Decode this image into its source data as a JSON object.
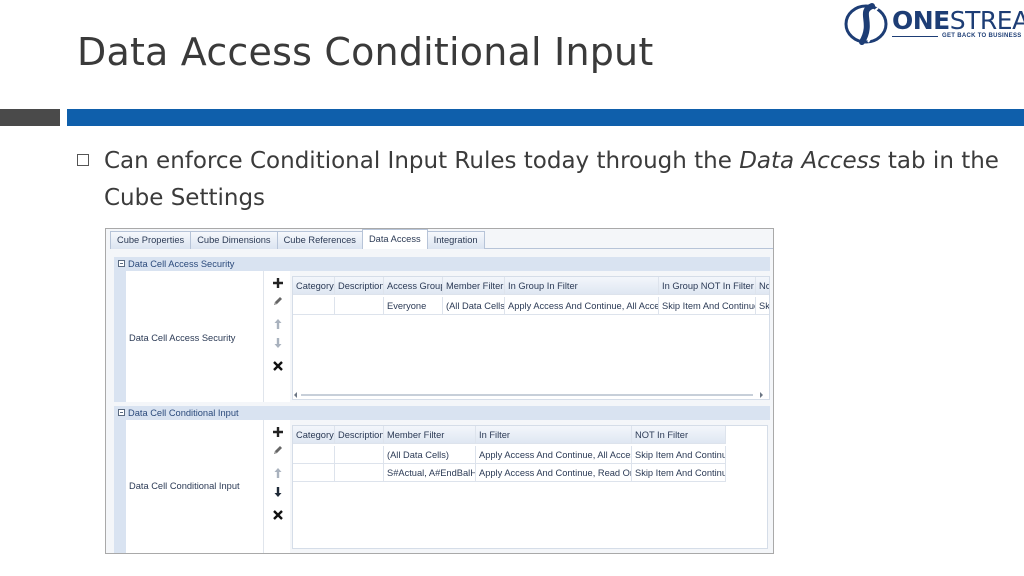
{
  "slide": {
    "title": "Data Access Conditional Input",
    "bullet_pre": "Can enforce Conditional Input Rules today through the ",
    "bullet_em": "Data Access",
    "bullet_post": " tab in the Cube Settings"
  },
  "logo": {
    "word_bold": "ONE",
    "word_light": "STREAM",
    "tagline": "GET BACK TO BUSINESS",
    "brand_color": "#1d3d75"
  },
  "colors": {
    "accent_band": "#0f5fab",
    "dark_band": "#4a4a4a",
    "section_header_bg": "#d9e3f1"
  },
  "tabs": [
    {
      "label": "Cube Properties",
      "active": false
    },
    {
      "label": "Cube Dimensions",
      "active": false
    },
    {
      "label": "Cube References",
      "active": false
    },
    {
      "label": "Data Access",
      "active": true
    },
    {
      "label": "Integration",
      "active": false
    }
  ],
  "security": {
    "header": "Data Cell Access Security",
    "label": "Data Cell Access Security",
    "tools": [
      "add-icon",
      "edit-icon",
      "move-up-icon",
      "move-down-icon",
      "delete-icon"
    ],
    "columns": [
      "Category",
      "Description",
      "Access Group",
      "Member Filter",
      "In Group In Filter",
      "In Group NOT In Filter",
      "No"
    ],
    "rows": [
      [
        "",
        "",
        "Everyone",
        "(All Data Cells)",
        "Apply Access And Continue, All Access",
        "Skip Item And Continue",
        "Sk"
      ]
    ]
  },
  "conditional": {
    "header": "Data Cell Conditional Input",
    "label": "Data Cell Conditional Input",
    "tools": [
      "add-icon",
      "edit-icon",
      "move-up-icon",
      "move-down-icon",
      "delete-icon"
    ],
    "columns": [
      "Category",
      "Description",
      "Member Filter",
      "In Filter",
      "NOT In Filter"
    ],
    "rows": [
      [
        "",
        "",
        "(All Data Cells)",
        "Apply Access And Continue, All Access",
        "Skip Item And Continue"
      ],
      [
        "",
        "",
        "S#Actual, A#EndBalHC",
        "Apply Access And Continue, Read Only",
        "Skip Item And Continue"
      ]
    ]
  }
}
